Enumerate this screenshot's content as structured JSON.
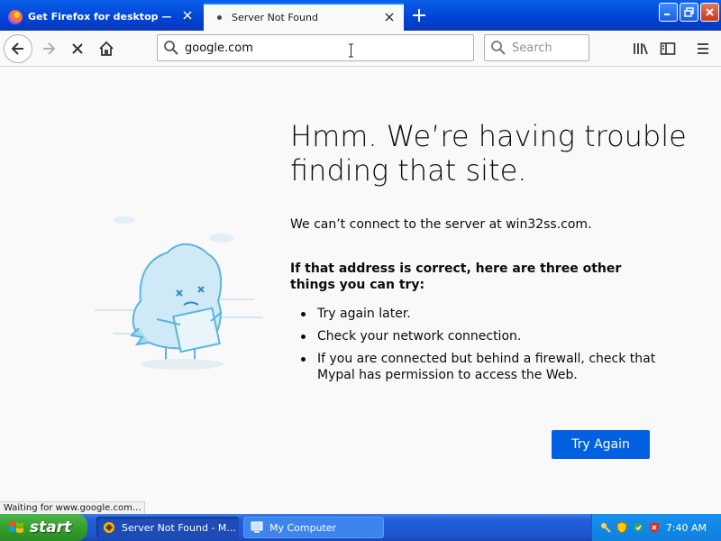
{
  "tabs": [
    {
      "label": "Get Firefox for desktop — Mozilla",
      "active": false,
      "icon": "firefox-icon"
    },
    {
      "label": "Server Not Found",
      "active": true,
      "icon": "loading-dot-icon"
    }
  ],
  "nav": {
    "url": "google.com",
    "search_placeholder": "Search"
  },
  "page": {
    "title": "Hmm. We’re having trouble finding that site.",
    "description": "We can’t connect to the server at win32ss.com.",
    "subheading": "If that address is correct, here are three other things you can try:",
    "tips": [
      "Try again later.",
      "Check your network connection.",
      "If you are connected but behind a firewall, check that Mypal has permission to access the Web."
    ],
    "button_label": "Try Again"
  },
  "status": "Waiting for www.google.com...",
  "taskbar": {
    "start_label": "start",
    "items": [
      {
        "label": "Server Not Found - M...",
        "icon": "mypal-icon"
      },
      {
        "label": "My Computer",
        "icon": "computer-icon"
      }
    ],
    "clock": "7:40 AM"
  },
  "colors": {
    "accent": "#0060df",
    "titlebar": "#0043d6",
    "start": "#35a02e"
  }
}
